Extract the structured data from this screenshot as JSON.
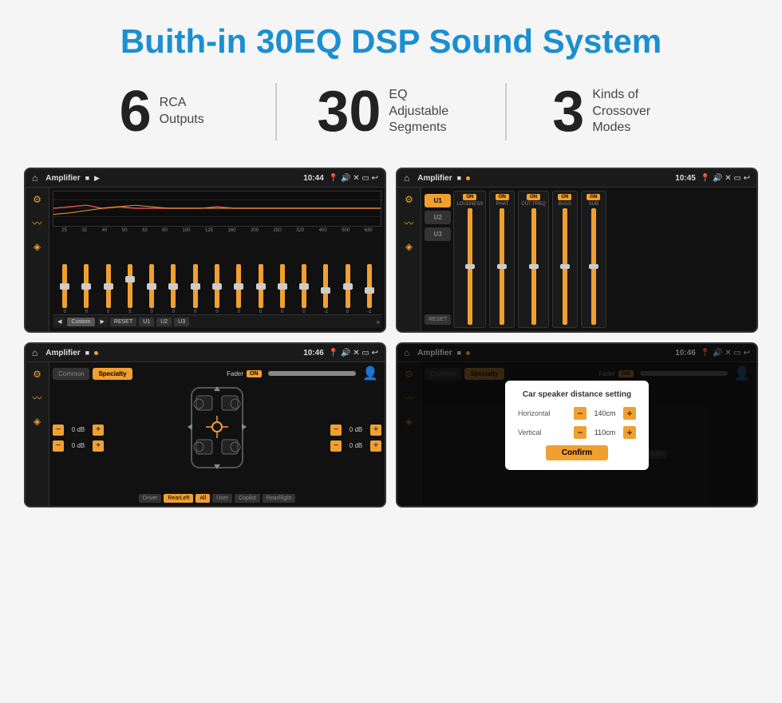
{
  "header": {
    "title": "Buith-in 30EQ DSP Sound System"
  },
  "stats": [
    {
      "number": "6",
      "line1": "RCA",
      "line2": "Outputs"
    },
    {
      "number": "30",
      "line1": "EQ Adjustable",
      "line2": "Segments"
    },
    {
      "number": "3",
      "line1": "Kinds of",
      "line2": "Crossover Modes"
    }
  ],
  "screens": [
    {
      "id": "eq-screen",
      "statusbar": {
        "appname": "Amplifier",
        "time": "10:44",
        "dots": [
          "record",
          "play"
        ]
      }
    },
    {
      "id": "crossover-screen",
      "statusbar": {
        "appname": "Amplifier",
        "time": "10:45",
        "dots": [
          "record",
          "dot-orange"
        ]
      }
    },
    {
      "id": "fader-screen",
      "statusbar": {
        "appname": "Amplifier",
        "time": "10:46",
        "dots": [
          "record",
          "dot-orange"
        ]
      }
    },
    {
      "id": "dialog-screen",
      "statusbar": {
        "appname": "Amplifier",
        "time": "10:46",
        "dots": [
          "record",
          "dot-orange"
        ]
      },
      "dialog": {
        "title": "Car speaker distance setting",
        "fields": [
          {
            "label": "Horizontal",
            "value": "140cm"
          },
          {
            "label": "Vertical",
            "value": "110cm"
          }
        ],
        "confirm_label": "Confirm"
      }
    }
  ],
  "eq_presets": [
    "Custom",
    "RESET",
    "U1",
    "U2",
    "U3"
  ],
  "eq_freqs": [
    "25",
    "32",
    "40",
    "50",
    "63",
    "80",
    "100",
    "125",
    "160",
    "200",
    "250",
    "320",
    "400",
    "500",
    "630"
  ],
  "eq_values": [
    "0",
    "0",
    "0",
    "5",
    "0",
    "0",
    "0",
    "0",
    "0",
    "0",
    "0",
    "0",
    "-1",
    "0",
    "-1"
  ],
  "crossover_presets": [
    "U1",
    "U2",
    "U3"
  ],
  "crossover_params": [
    "LOUDNESS",
    "PHAT",
    "CUT FREQ",
    "BASS",
    "SUB"
  ],
  "fader": {
    "tabs": [
      "Common",
      "Specialty"
    ],
    "fader_label": "Fader",
    "on_label": "ON",
    "vol_rows": [
      {
        "value": "0 dB"
      },
      {
        "value": "0 dB"
      },
      {
        "value": "0 dB"
      },
      {
        "value": "0 dB"
      }
    ],
    "speaker_buttons": [
      "Driver",
      "RearLeft",
      "All",
      "User",
      "Copilot",
      "RearRight"
    ]
  },
  "dialog": {
    "title": "Car speaker distance setting",
    "horizontal_label": "Horizontal",
    "horizontal_value": "140cm",
    "vertical_label": "Vertical",
    "vertical_value": "110cm",
    "confirm_label": "Confirm"
  }
}
